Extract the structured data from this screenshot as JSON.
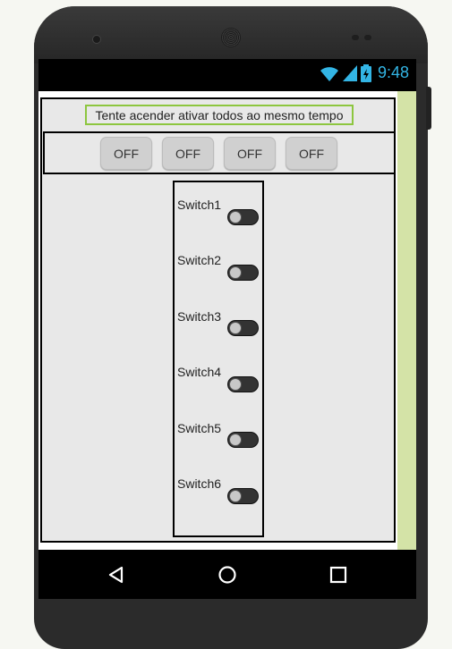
{
  "statusbar": {
    "time": "9:48",
    "icons": [
      "wifi-icon",
      "signal-icon",
      "battery-icon"
    ],
    "accent_color": "#33b5e5"
  },
  "app": {
    "title_label": "Tente acender ativar todos ao mesmo tempo",
    "buttons": [
      {
        "label": "OFF"
      },
      {
        "label": "OFF"
      },
      {
        "label": "OFF"
      },
      {
        "label": "OFF"
      }
    ],
    "switches": [
      {
        "label": "Switch1",
        "on": false
      },
      {
        "label": "Switch2",
        "on": false
      },
      {
        "label": "Switch3",
        "on": false
      },
      {
        "label": "Switch4",
        "on": false
      },
      {
        "label": "Switch5",
        "on": false
      },
      {
        "label": "Switch6",
        "on": false
      }
    ],
    "colors": {
      "label_border": "#8dc63f",
      "scroll_strip": "#d4e3a7",
      "background": "#e8e8e8"
    }
  },
  "navbar": {
    "icons": [
      "back-icon",
      "home-icon",
      "recents-icon"
    ]
  }
}
